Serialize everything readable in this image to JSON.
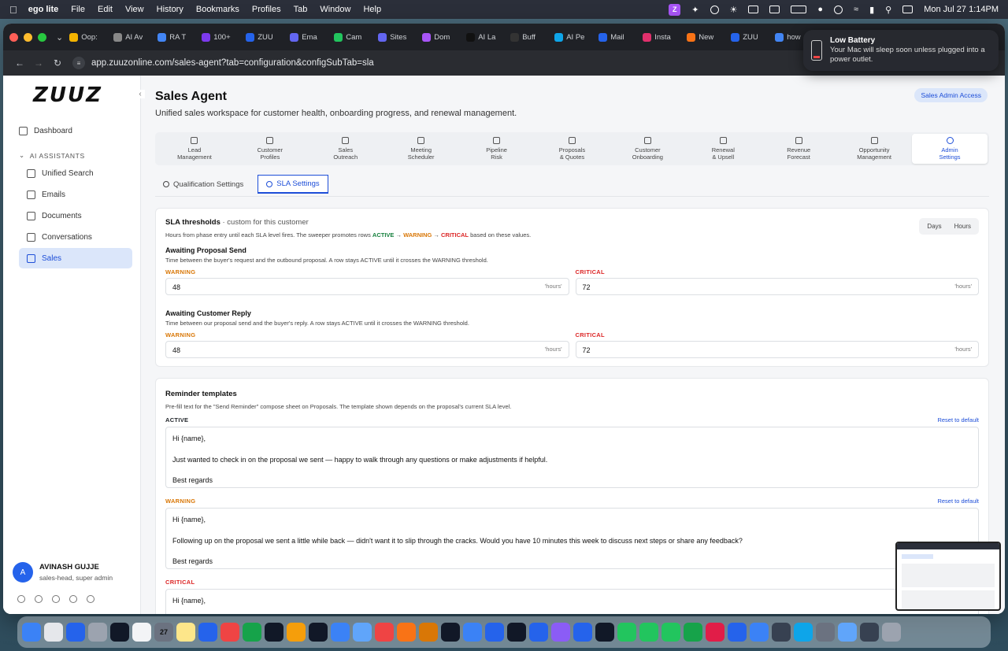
{
  "menubar": {
    "app_name": "ego lite",
    "menus": [
      "File",
      "Edit",
      "View",
      "History",
      "Bookmarks",
      "Profiles",
      "Tab",
      "Window",
      "Help"
    ],
    "clock": "Mon Jul 27  1:14PM"
  },
  "browser": {
    "tabs": [
      {
        "label": "Oop:",
        "color": "#f4b400"
      },
      {
        "label": "AI Av",
        "color": "#888888"
      },
      {
        "label": "RA T",
        "color": "#4285f4"
      },
      {
        "label": "100+",
        "color": "#7c3aed"
      },
      {
        "label": "ZUU",
        "color": "#2563eb"
      },
      {
        "label": "Ema",
        "color": "#6366f1"
      },
      {
        "label": "Cam",
        "color": "#22c55e"
      },
      {
        "label": "Sites",
        "color": "#6366f1"
      },
      {
        "label": "Dom",
        "color": "#a855f7"
      },
      {
        "label": "AI La",
        "color": "#111111"
      },
      {
        "label": "Buff",
        "color": "#333333"
      },
      {
        "label": "AI Pe",
        "color": "#0ea5e9"
      },
      {
        "label": "Mail",
        "color": "#2563eb"
      },
      {
        "label": "Insta",
        "color": "#e1306c"
      },
      {
        "label": "New",
        "color": "#f97316"
      },
      {
        "label": "ZUU",
        "color": "#2563eb"
      },
      {
        "label": "how",
        "color": "#4285f4"
      }
    ],
    "url": "app.zuuzonline.com/sales-agent?tab=configuration&configSubTab=sla"
  },
  "notification": {
    "title": "Low Battery",
    "body": "Your Mac will sleep soon unless plugged into a power outlet."
  },
  "sidebar": {
    "logo": "ZUUZ",
    "dashboard": "Dashboard",
    "section": "AI ASSISTANTS",
    "items": [
      {
        "label": "Unified Search"
      },
      {
        "label": "Emails"
      },
      {
        "label": "Documents"
      },
      {
        "label": "Conversations"
      },
      {
        "label": "Sales"
      }
    ],
    "user": {
      "name": "AVINASH GUJJE",
      "role": "sales-head, super admin",
      "initial": "A"
    }
  },
  "page": {
    "title": "Sales Agent",
    "subtitle": "Unified sales workspace for customer health, onboarding progress, and renewal management.",
    "access_badge": "Sales Admin Access"
  },
  "module_tabs": [
    {
      "l1": "Lead",
      "l2": "Management"
    },
    {
      "l1": "Customer",
      "l2": "Profiles"
    },
    {
      "l1": "Sales",
      "l2": "Outreach"
    },
    {
      "l1": "Meeting",
      "l2": "Scheduler"
    },
    {
      "l1": "Pipeline",
      "l2": "Risk"
    },
    {
      "l1": "Proposals",
      "l2": "& Quotes"
    },
    {
      "l1": "Customer",
      "l2": "Onboarding"
    },
    {
      "l1": "Renewal",
      "l2": "& Upsell"
    },
    {
      "l1": "Revenue",
      "l2": "Forecast"
    },
    {
      "l1": "Opportunity",
      "l2": "Management"
    },
    {
      "l1": "Admin",
      "l2": "Settings"
    }
  ],
  "sub_tabs": {
    "qualification": "Qualification Settings",
    "sla": "SLA Settings"
  },
  "thresholds": {
    "title": "SLA thresholds",
    "title_suffix": " · custom for this customer",
    "desc_pre": "Hours from phase entry until each SLA level fires. The sweeper promotes rows ",
    "active": "ACTIVE",
    "arrow": " → ",
    "warning": "WARNING",
    "critical": "CRITICAL",
    "desc_post": " based on these values.",
    "unit_days": "Days",
    "unit_hours": "Hours",
    "groups": [
      {
        "title": "Awaiting Proposal Send",
        "desc": "Time between the buyer's request and the outbound proposal. A row stays ACTIVE until it crosses the WARNING threshold.",
        "warning_value": "48",
        "critical_value": "72",
        "suffix": "'hours'"
      },
      {
        "title": "Awaiting Customer Reply",
        "desc": "Time between our proposal send and the buyer's reply. A row stays ACTIVE until it crosses the WARNING threshold.",
        "warning_value": "48",
        "critical_value": "72",
        "suffix": "'hours'"
      }
    ]
  },
  "templates": {
    "title": "Reminder templates",
    "desc": "Pre-fill text for the \"Send Reminder\" compose sheet on Proposals. The template shown depends on the proposal's current SLA level.",
    "reset": "Reset to default",
    "active": {
      "label": "ACTIVE",
      "greeting": "Hi {name},",
      "body": "Just wanted to check in on the proposal we sent — happy to walk through any questions or make adjustments if helpful.",
      "signoff": "Best regards"
    },
    "warning": {
      "label": "WARNING",
      "greeting": "Hi {name},",
      "body": "Following up on the proposal we sent a little while back — didn't want it to slip through the cracks. Would you have 10 minutes this week to discuss next steps or share any feedback?",
      "signoff": "Best regards"
    },
    "critical": {
      "label": "CRITICAL",
      "greeting": "Hi {name},"
    }
  },
  "dock": {
    "calendar_day": "27",
    "icon_colors": [
      "#3b82f6",
      "#e5e7eb",
      "#2563eb",
      "#9ca3af",
      "#111827",
      "#f3f4f6",
      "#6b7280",
      "#fde68a",
      "#2563eb",
      "#ef4444",
      "#16a34a",
      "#111827",
      "#f59e0b",
      "#111827",
      "#3b82f6",
      "#60a5fa",
      "#ef4444",
      "#f97316",
      "#d97706",
      "#111827",
      "#3b82f6",
      "#2563eb",
      "#111827",
      "#2563eb",
      "#8b5cf6",
      "#2563eb",
      "#111827",
      "#22c55e",
      "#22c55e",
      "#22c55e",
      "#16a34a",
      "#e11d48",
      "#2563eb",
      "#3b82f6",
      "#374151",
      "#0ea5e9",
      "#6b7280",
      "#60a5fa",
      "#374151",
      "#9ca3af"
    ]
  }
}
